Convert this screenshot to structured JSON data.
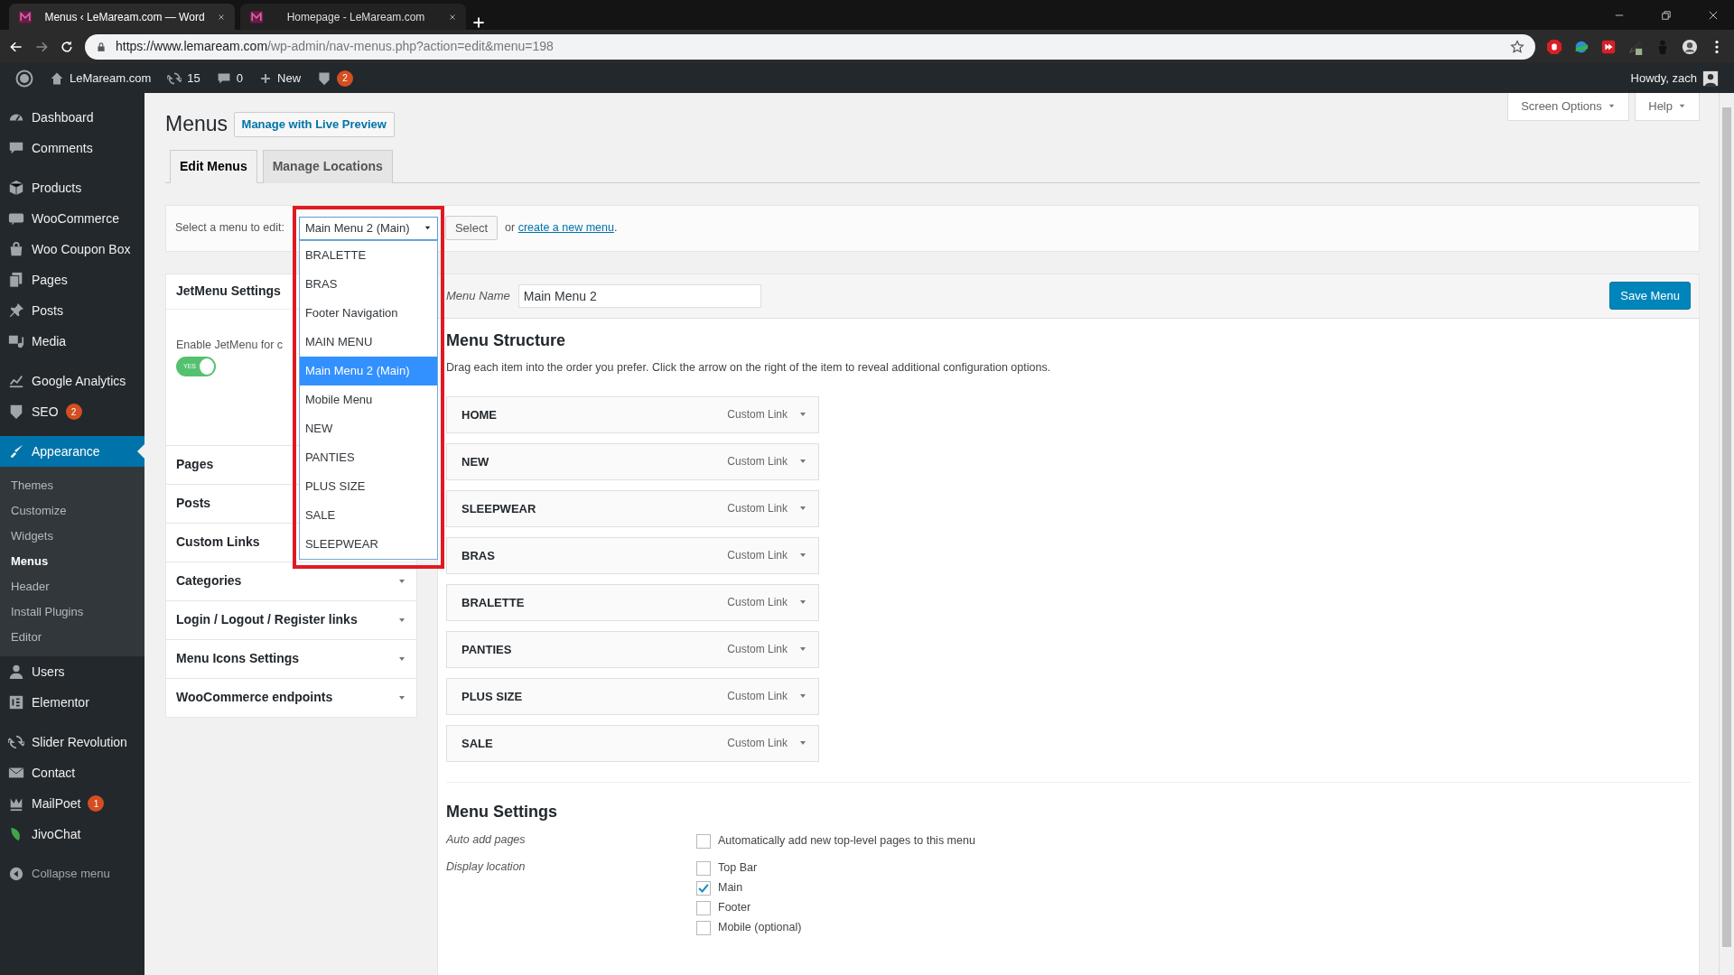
{
  "browser": {
    "tabs": [
      {
        "title": "Menus ‹ LeMaream.com — Word",
        "selected": true
      },
      {
        "title": "Homepage - LeMaream.com",
        "selected": false
      }
    ],
    "url_host": "https://www.lemaream.com",
    "url_path": "/wp-admin/nav-menus.php?action=edit&menu=198"
  },
  "admin_bar": {
    "site": "LeMaream.com",
    "updates": "15",
    "comments": "0",
    "new": "New",
    "seo_badge": "2",
    "greeting": "Howdy, zach"
  },
  "sidebar": {
    "groups": [
      [
        {
          "label": "Dashboard",
          "selected": false
        },
        {
          "label": "Comments",
          "selected": false
        }
      ],
      [
        {
          "label": "Products",
          "selected": false
        },
        {
          "label": "WooCommerce",
          "selected": false
        },
        {
          "label": "Woo Coupon Box",
          "selected": false
        },
        {
          "label": "Pages",
          "selected": false
        },
        {
          "label": "Posts",
          "selected": false
        },
        {
          "label": "Media",
          "selected": false
        }
      ],
      [
        {
          "label": "Google Analytics",
          "selected": false
        },
        {
          "label": "SEO",
          "selected": false,
          "badge": "2"
        }
      ],
      [
        {
          "label": "Appearance",
          "selected": true,
          "submenu": [
            {
              "label": "Themes",
              "selected": false
            },
            {
              "label": "Customize",
              "selected": false
            },
            {
              "label": "Widgets",
              "selected": false
            },
            {
              "label": "Menus",
              "selected": true
            },
            {
              "label": "Header",
              "selected": false
            },
            {
              "label": "Install Plugins",
              "selected": false
            },
            {
              "label": "Editor",
              "selected": false
            }
          ]
        },
        {
          "label": "Users",
          "selected": false
        },
        {
          "label": "Elementor",
          "selected": false
        }
      ],
      [
        {
          "label": "Slider Revolution",
          "selected": false
        },
        {
          "label": "Contact",
          "selected": false
        },
        {
          "label": "MailPoet",
          "selected": false,
          "badge": "1"
        },
        {
          "label": "JivoChat",
          "selected": false
        }
      ]
    ],
    "collapse": "Collapse menu"
  },
  "page": {
    "title": "Menus",
    "preview_button": "Manage with Live Preview",
    "screen_options": "Screen Options",
    "help": "Help",
    "tabs": [
      {
        "label": "Edit Menus",
        "selected": true
      },
      {
        "label": "Manage Locations",
        "selected": false
      }
    ]
  },
  "select_bar": {
    "label": "Select a menu to edit:",
    "value": "Main Menu 2 (Main)",
    "button": "Select",
    "or_text": "or",
    "create_link": "create a new menu",
    "period": ".",
    "options": [
      {
        "label": "BRALETTE",
        "selected": false
      },
      {
        "label": "BRAS",
        "selected": false
      },
      {
        "label": "Footer Navigation",
        "selected": false
      },
      {
        "label": "MAIN MENU",
        "selected": false
      },
      {
        "label": "Main Menu 2 (Main)",
        "selected": true
      },
      {
        "label": "Mobile Menu",
        "selected": false
      },
      {
        "label": "NEW",
        "selected": false
      },
      {
        "label": "PANTIES",
        "selected": false
      },
      {
        "label": "PLUS SIZE",
        "selected": false
      },
      {
        "label": "SALE",
        "selected": false
      },
      {
        "label": "SLEEPWEAR",
        "selected": false
      }
    ]
  },
  "left_panel": {
    "jetmenu": {
      "title": "JetMenu Settings",
      "label": "Enable JetMenu for c",
      "toggle": {
        "on": true,
        "label": "YES"
      }
    },
    "sections": [
      {
        "label": "Pages",
        "caret": false
      },
      {
        "label": "Posts",
        "caret": false
      },
      {
        "label": "Custom Links",
        "caret": false
      },
      {
        "label": "Categories",
        "caret": true
      },
      {
        "label": "Login / Logout / Register links",
        "caret": true
      },
      {
        "label": "Menu Icons Settings",
        "caret": true
      },
      {
        "label": "WooCommerce endpoints",
        "caret": true
      }
    ]
  },
  "menu_editor": {
    "name_label": "Menu Name",
    "name_value": "Main Menu 2",
    "save_button": "Save Menu",
    "structure_title": "Menu Structure",
    "structure_hint": "Drag each item into the order you prefer. Click the arrow on the right of the item to reveal additional configuration options.",
    "items": [
      {
        "label": "HOME",
        "type": "Custom Link"
      },
      {
        "label": "NEW",
        "type": "Custom Link"
      },
      {
        "label": "SLEEPWEAR",
        "type": "Custom Link"
      },
      {
        "label": "BRAS",
        "type": "Custom Link"
      },
      {
        "label": "BRALETTE",
        "type": "Custom Link"
      },
      {
        "label": "PANTIES",
        "type": "Custom Link"
      },
      {
        "label": "PLUS SIZE",
        "type": "Custom Link"
      },
      {
        "label": "SALE",
        "type": "Custom Link"
      }
    ],
    "settings_title": "Menu Settings",
    "settings": [
      {
        "label": "Auto add pages",
        "options": [
          {
            "label": "Automatically add new top-level pages to this menu",
            "checked": false
          }
        ]
      },
      {
        "label": "Display location",
        "options": [
          {
            "label": "Top Bar",
            "checked": false
          },
          {
            "label": "Main",
            "checked": true
          },
          {
            "label": "Footer",
            "checked": false
          },
          {
            "label": "Mobile (optional)",
            "checked": false
          }
        ]
      }
    ]
  }
}
